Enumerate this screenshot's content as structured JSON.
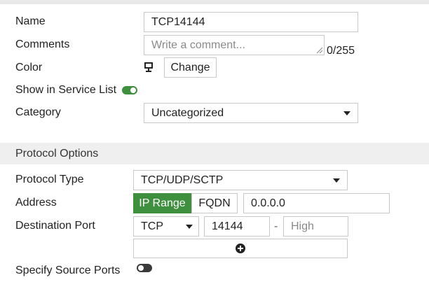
{
  "form": {
    "name": {
      "label": "Name",
      "value": "TCP14144"
    },
    "comments": {
      "label": "Comments",
      "placeholder": "Write a comment...",
      "counter": "0/255"
    },
    "color": {
      "label": "Color",
      "icon": "monitor-color-icon",
      "change_label": "Change"
    },
    "show_in_list": {
      "label": "Show in Service List",
      "enabled": true
    },
    "category": {
      "label": "Category",
      "value": "Uncategorized"
    }
  },
  "protocol_options": {
    "title": "Protocol Options",
    "protocol_type": {
      "label": "Protocol Type",
      "value": "TCP/UDP/SCTP"
    },
    "address": {
      "label": "Address",
      "ip_range_label": "IP Range",
      "fqdn_label": "FQDN",
      "value": "0.0.0.0"
    },
    "destination_port": {
      "label": "Destination Port",
      "protocol": "TCP",
      "low": "14144",
      "separator": "-",
      "high_placeholder": "High"
    },
    "add_icon": "plus-circle-icon",
    "specify_source_ports": {
      "label": "Specify Source Ports",
      "enabled": false
    }
  },
  "colors": {
    "accent_green": "#3e8f3e",
    "toggle_off": "#3a3a3a"
  }
}
